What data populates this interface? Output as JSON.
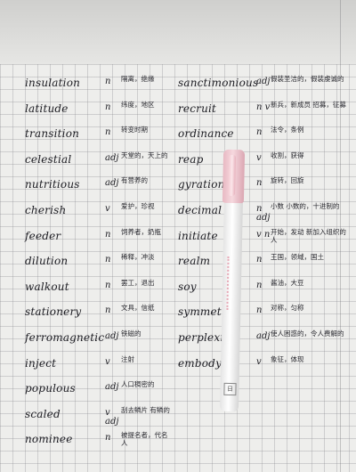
{
  "left_column": [
    {
      "word": "insulation",
      "pos": "n",
      "gloss": "隔离，绝缘"
    },
    {
      "word": "latitude",
      "pos": "n",
      "gloss": "纬度，地区"
    },
    {
      "word": "transition",
      "pos": "n",
      "gloss": "转变时期"
    },
    {
      "word": "celestial",
      "pos": "adj",
      "gloss": "天堂的，天上的"
    },
    {
      "word": "nutritious",
      "pos": "adj",
      "gloss": "有营养的"
    },
    {
      "word": "cherish",
      "pos": "v",
      "gloss": "爱护，珍视"
    },
    {
      "word": "feeder",
      "pos": "n",
      "gloss": "饲养者，奶瓶"
    },
    {
      "word": "dilution",
      "pos": "n",
      "gloss": "稀释，冲淡"
    },
    {
      "word": "walkout",
      "pos": "n",
      "gloss": "罢工，退出"
    },
    {
      "word": "stationery",
      "pos": "n",
      "gloss": "文具，信纸"
    },
    {
      "word": "ferromagnetic",
      "pos": "adj",
      "gloss": "铁磁的"
    },
    {
      "word": "inject",
      "pos": "v",
      "gloss": "注射"
    },
    {
      "word": "populous",
      "pos": "adj",
      "gloss": "人口稠密的"
    },
    {
      "word": "scaled",
      "pos": "v adj",
      "gloss": "刮去鳞片 有鳞的"
    },
    {
      "word": "nominee",
      "pos": "n",
      "gloss": "被提名者，代名人"
    }
  ],
  "right_column": [
    {
      "word": "sanctimonious",
      "pos": "adj",
      "gloss": "假装圣洁的，假装虔诚的"
    },
    {
      "word": "recruit",
      "pos": "n v",
      "gloss": "新兵，新成员 招募，征募"
    },
    {
      "word": "ordinance",
      "pos": "n",
      "gloss": "法令，条例"
    },
    {
      "word": "reap",
      "pos": "v",
      "gloss": "收割，获得"
    },
    {
      "word": "gyration",
      "pos": "n",
      "gloss": "旋转，回旋"
    },
    {
      "word": "decimal",
      "pos": "n adj",
      "gloss": "小数 小数的，十进制的"
    },
    {
      "word": "initiate",
      "pos": "v n",
      "gloss": "开始，发动 新加入组织的人"
    },
    {
      "word": "realm",
      "pos": "n",
      "gloss": "王国，领域，国土"
    },
    {
      "word": "soy",
      "pos": "n",
      "gloss": "酱油，大豆"
    },
    {
      "word": "symmetry",
      "pos": "n",
      "gloss": "对称，匀称"
    },
    {
      "word": "perplexing",
      "pos": "adj",
      "gloss": "使人困惑的，令人费解的"
    },
    {
      "word": "embody",
      "pos": "v",
      "gloss": "象征，体现"
    }
  ],
  "colors": {
    "ink": "#1c1c22",
    "paper": "#eeeeec",
    "pen_cap": "#f0c6cf"
  },
  "pen": {
    "label": "日"
  }
}
